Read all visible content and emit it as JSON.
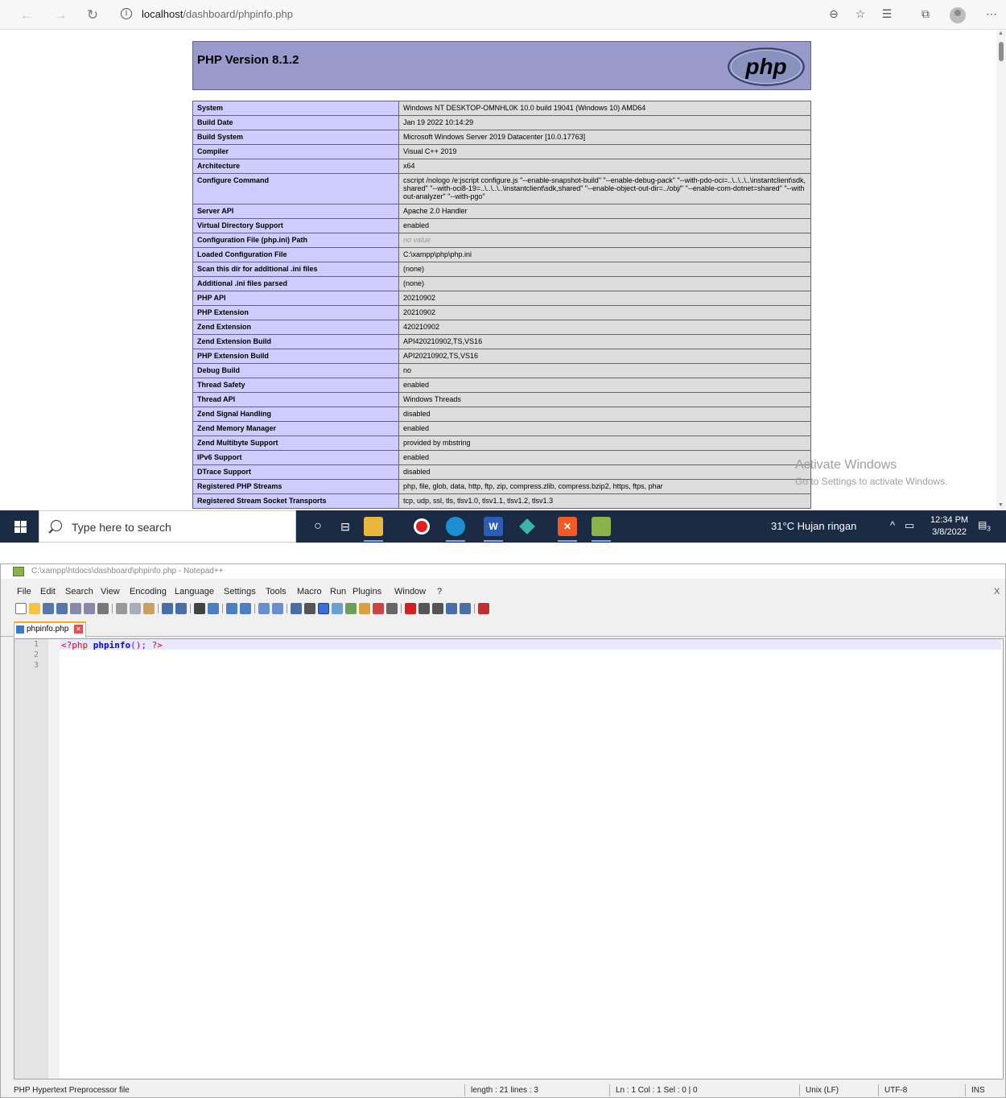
{
  "browser": {
    "url_host": "localhost",
    "url_path": "/dashboard/phpinfo.php",
    "header_title": "PHP Version 8.1.2",
    "logo_text": "php",
    "rows": [
      {
        "key": "System",
        "value": "Windows NT DESKTOP-OMNHL0K 10.0 build 19041 (Windows 10) AMD64"
      },
      {
        "key": "Build Date",
        "value": "Jan 19 2022 10:14:29"
      },
      {
        "key": "Build System",
        "value": "Microsoft Windows Server 2019 Datacenter [10.0.17763]"
      },
      {
        "key": "Compiler",
        "value": "Visual C++ 2019"
      },
      {
        "key": "Architecture",
        "value": "x64"
      },
      {
        "key": "Configure Command",
        "value": "cscript /nologo /e:jscript configure.js \"--enable-snapshot-build\" \"--enable-debug-pack\" \"--with-pdo-oci=..\\..\\..\\..\\instantclient\\sdk,shared\" \"--with-oci8-19=..\\..\\..\\..\\instantclient\\sdk,shared\" \"--enable-object-out-dir=../obj/\" \"--enable-com-dotnet=shared\" \"--without-analyzer\" \"--with-pgo\""
      },
      {
        "key": "Server API",
        "value": "Apache 2.0 Handler"
      },
      {
        "key": "Virtual Directory Support",
        "value": "enabled"
      },
      {
        "key": "Configuration File (php.ini) Path",
        "value": "no value"
      },
      {
        "key": "Loaded Configuration File",
        "value": "C:\\xampp\\php\\php.ini"
      },
      {
        "key": "Scan this dir for additional .ini files",
        "value": "(none)"
      },
      {
        "key": "Additional .ini files parsed",
        "value": "(none)"
      },
      {
        "key": "PHP API",
        "value": "20210902"
      },
      {
        "key": "PHP Extension",
        "value": "20210902"
      },
      {
        "key": "Zend Extension",
        "value": "420210902"
      },
      {
        "key": "Zend Extension Build",
        "value": "API420210902,TS,VS16"
      },
      {
        "key": "PHP Extension Build",
        "value": "API20210902,TS,VS16"
      },
      {
        "key": "Debug Build",
        "value": "no"
      },
      {
        "key": "Thread Safety",
        "value": "enabled"
      },
      {
        "key": "Thread API",
        "value": "Windows Threads"
      },
      {
        "key": "Zend Signal Handling",
        "value": "disabled"
      },
      {
        "key": "Zend Memory Manager",
        "value": "enabled"
      },
      {
        "key": "Zend Multibyte Support",
        "value": "provided by mbstring"
      },
      {
        "key": "IPv6 Support",
        "value": "enabled"
      },
      {
        "key": "DTrace Support",
        "value": "disabled"
      },
      {
        "key": "Registered PHP Streams",
        "value": "php, file, glob, data, http, ftp, zip, compress.zlib, compress.bzip2, https, ftps, phar"
      },
      {
        "key": "Registered Stream Socket Transports",
        "value": "tcp, udp, ssl, tls, tlsv1.0, tlsv1.1, tlsv1.2, tlsv1.3"
      }
    ],
    "watermark": {
      "line1": "Activate Windows",
      "line2": "Go to Settings to activate Windows."
    }
  },
  "taskbar": {
    "search_placeholder": "Type here to search",
    "weather": "31°C  Hujan ringan",
    "time": "12:34 PM",
    "date": "3/8/2022",
    "notification_count": "3"
  },
  "notepad": {
    "title": "C:\\xampp\\htdocs\\dashboard\\phpinfo.php - Notepad++",
    "menu": [
      "File",
      "Edit",
      "Search",
      "View",
      "Encoding",
      "Language",
      "Settings",
      "Tools",
      "Macro",
      "Run",
      "Plugins",
      "Window",
      "?"
    ],
    "close_x": "X",
    "tab_label": "phpinfo.php",
    "line_numbers": [
      "1",
      "2",
      "3"
    ],
    "code": {
      "open": "<?php ",
      "fn": "phpinfo",
      "punct": "(); ",
      "close": "?>"
    },
    "status": {
      "file_type": "PHP Hypertext Preprocessor file",
      "length": "length : 21    lines : 3",
      "position": "Ln : 1    Col : 1    Sel : 0 | 0",
      "eol": "Unix (LF)",
      "encoding": "UTF-8",
      "mode": "INS"
    }
  }
}
